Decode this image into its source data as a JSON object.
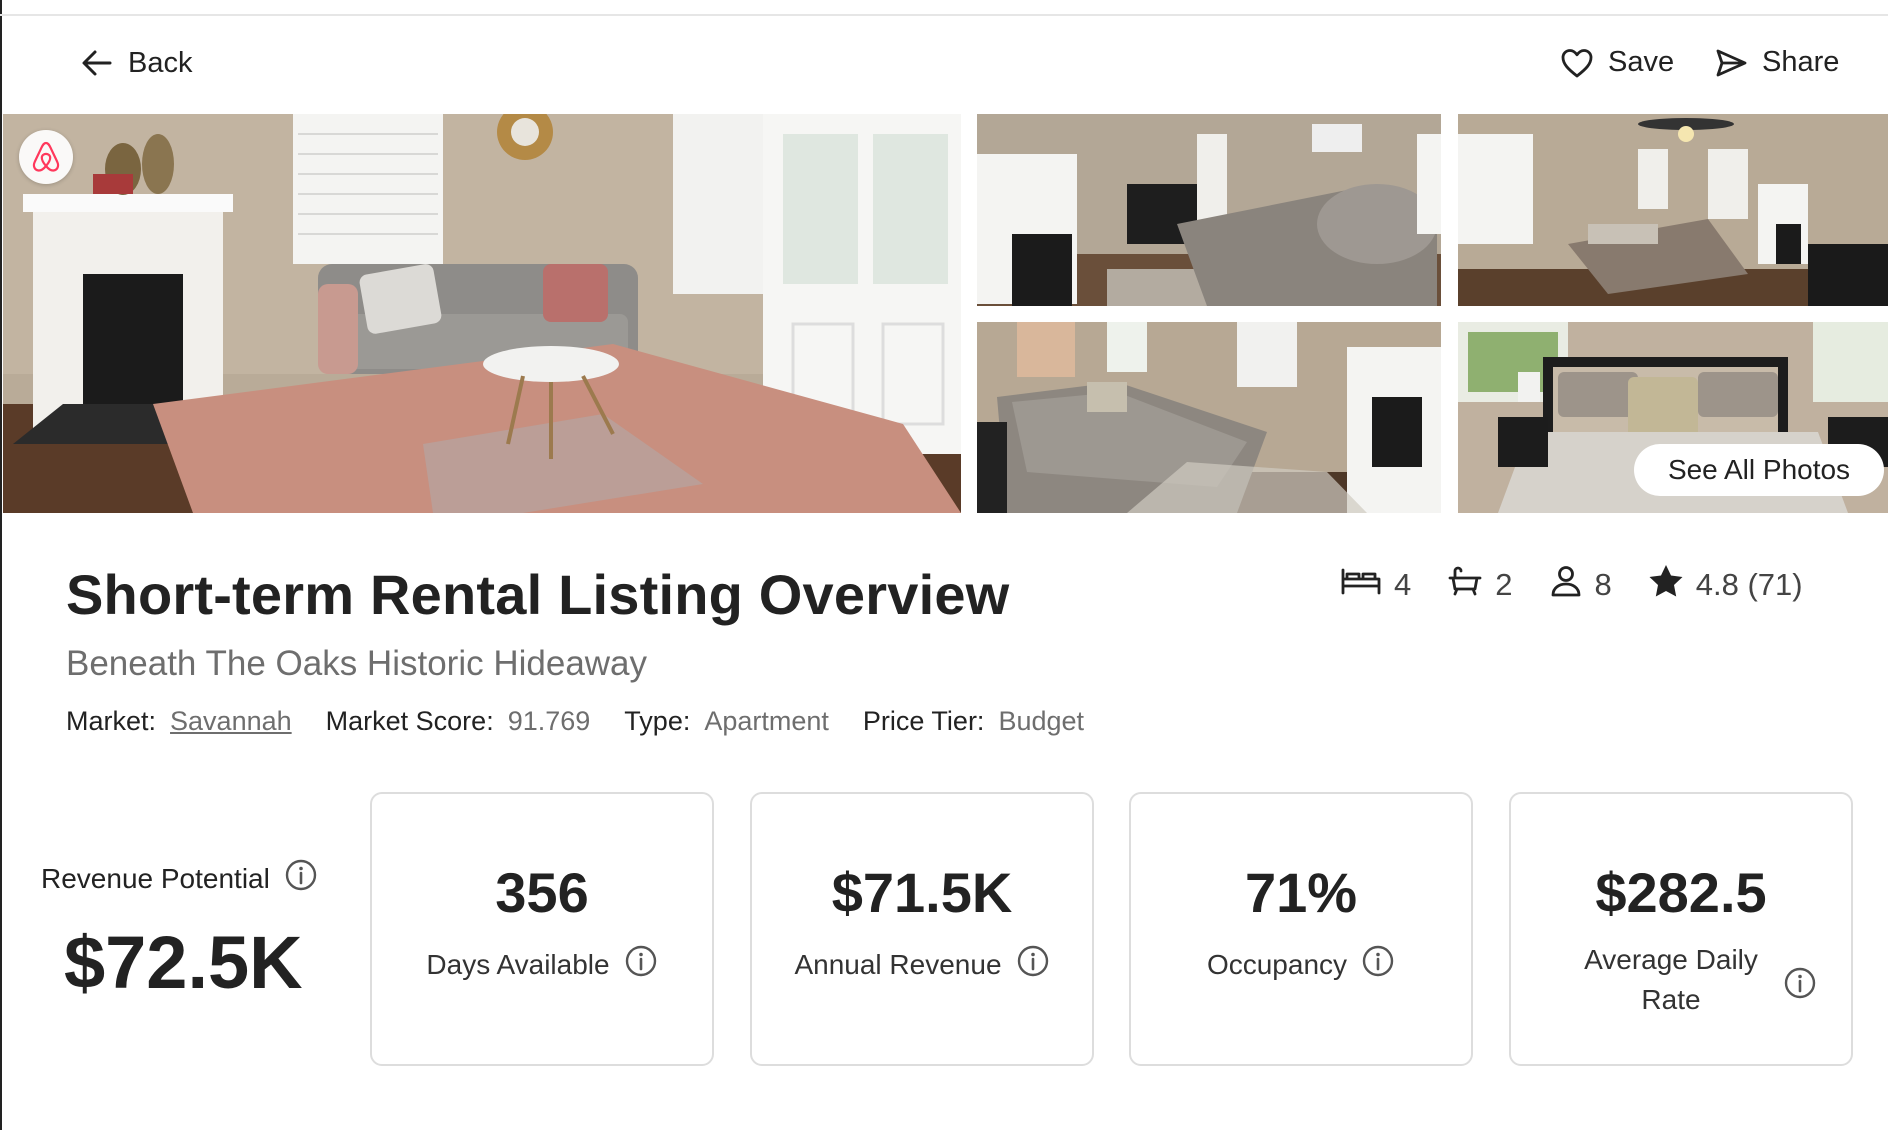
{
  "toolbar": {
    "back_label": "Back",
    "save_label": "Save",
    "share_label": "Share"
  },
  "gallery": {
    "see_all_label": "See All Photos"
  },
  "listing": {
    "title": "Short-term Rental Listing Overview",
    "name": "Beneath The Oaks Historic Hideaway",
    "market_key": "Market:",
    "market": "Savannah",
    "score_key": "Market Score:",
    "score": "91.769",
    "type_key": "Type:",
    "type": "Apartment",
    "tier_key": "Price Tier:",
    "tier": "Budget"
  },
  "stats": {
    "beds": "4",
    "baths": "2",
    "guests": "8",
    "rating": "4.8 (71)"
  },
  "revenue": {
    "label": "Revenue Potential",
    "value": "$72.5K"
  },
  "cards": [
    {
      "value": "356",
      "label": "Days Available"
    },
    {
      "value": "$71.5K",
      "label": "Annual Revenue"
    },
    {
      "value": "71%",
      "label": "Occupancy"
    },
    {
      "value": "$282.5",
      "label": "Average Daily Rate"
    }
  ],
  "icons": [
    "arrow-left-icon",
    "heart-icon",
    "send-icon",
    "bed-icon",
    "bathtub-icon",
    "person-icon",
    "star-icon",
    "info-icon",
    "airbnb-logo-icon"
  ],
  "colors": {
    "text": "#222222",
    "muted": "#6e6e6e",
    "border": "#dddddd",
    "airbnb": "#FF385C"
  }
}
